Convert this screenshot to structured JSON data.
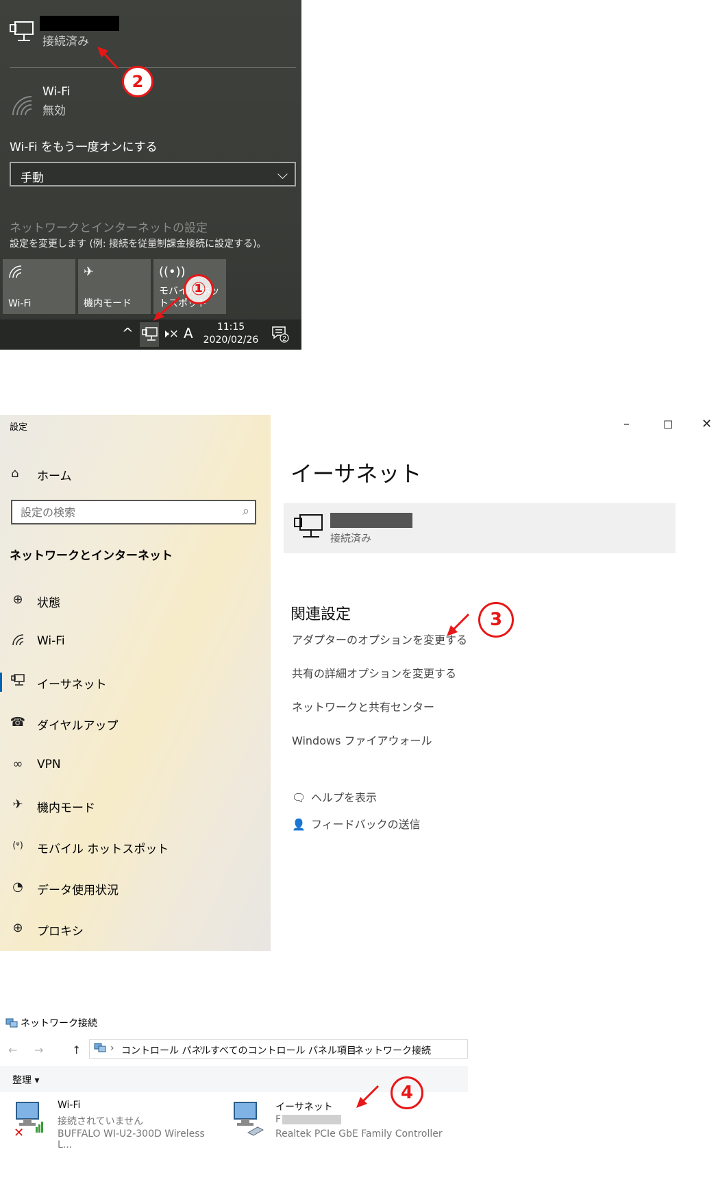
{
  "flyout": {
    "network_status": "接続済み",
    "wifi_title": "Wi-Fi",
    "wifi_status": "無効",
    "wifi_on_label": "Wi-Fi をもう一度オンにする",
    "dropdown_value": "手動",
    "settings_link": "ネットワークとインターネットの設定",
    "settings_sub": "設定を変更します (例: 接続を従量制課金接続に設定する)。",
    "tiles": [
      {
        "label": "Wi-Fi",
        "icon": "wifi-icon"
      },
      {
        "label": "機内モード",
        "icon": "airplane-icon"
      },
      {
        "label": "モバイル ホットスポット",
        "icon": "hotspot-icon"
      }
    ],
    "taskbar": {
      "time": "11:15",
      "date": "2020/02/26",
      "ime": "A",
      "notifications": "2"
    }
  },
  "annotations": {
    "one": "①",
    "two": "2",
    "three": "3",
    "four": "4"
  },
  "settings": {
    "window_title": "設定",
    "home_label": "ホーム",
    "search_placeholder": "設定の検索",
    "category_title": "ネットワークとインターネット",
    "nav_items": [
      {
        "label": "状態",
        "icon": "globe-status-icon"
      },
      {
        "label": "Wi-Fi",
        "icon": "wifi-icon"
      },
      {
        "label": "イーサネット",
        "icon": "ethernet-icon"
      },
      {
        "label": "ダイヤルアップ",
        "icon": "dialup-icon"
      },
      {
        "label": "VPN",
        "icon": "vpn-icon"
      },
      {
        "label": "機内モード",
        "icon": "airplane-icon"
      },
      {
        "label": "モバイル ホットスポット",
        "icon": "hotspot-icon"
      },
      {
        "label": "データ使用状況",
        "icon": "data-usage-icon"
      },
      {
        "label": "プロキシ",
        "icon": "proxy-icon"
      }
    ],
    "page_title": "イーサネット",
    "ethernet_status": "接続済み",
    "related_heading": "関連設定",
    "related_links": [
      "アダプターのオプションを変更する",
      "共有の詳細オプションを変更する",
      "ネットワークと共有センター",
      "Windows ファイアウォール"
    ],
    "help_label": "ヘルプを表示",
    "feedback_label": "フィードバックの送信"
  },
  "network_connections": {
    "title": "ネットワーク接続",
    "breadcrumbs": [
      "コントロール パネル",
      "すべてのコントロール パネル項目",
      "ネットワーク接続"
    ],
    "organize": "整理 ▾",
    "adapters": [
      {
        "name": "Wi-Fi",
        "status": "接続されていません",
        "device": "BUFFALO WI-U2-300D Wireless L..."
      },
      {
        "name": "イーサネット",
        "status": "F",
        "device": "Realtek PCIe GbE Family Controller"
      }
    ]
  }
}
